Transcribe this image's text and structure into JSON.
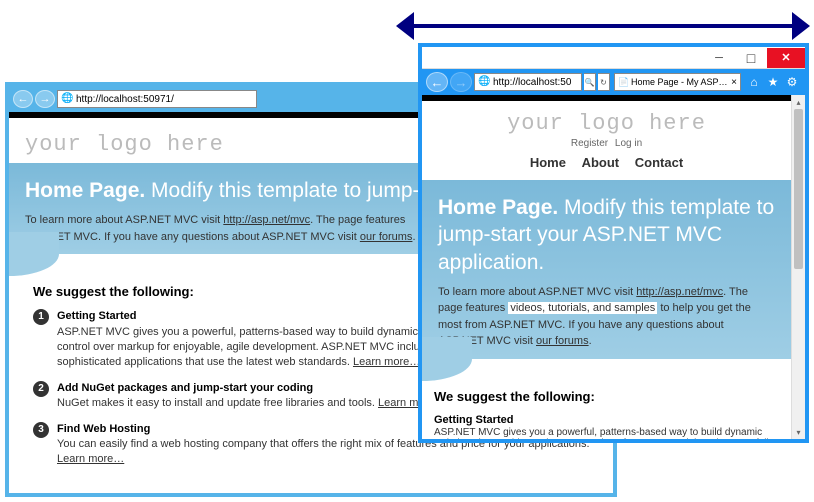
{
  "arrow": {
    "name": "resize-arrow"
  },
  "back_window": {
    "url": "http://localhost:50971/",
    "logo": "your logo here",
    "hero_title_bold": "Home Page.",
    "hero_title_rest": " Modify this template to jump-start",
    "hero_para_1": "To learn more about ASP.NET MVC visit ",
    "hero_link_1": "http://asp.net/mvc",
    "hero_para_2": ". The page features ",
    "hero_para_3": "ASP.NET MVC. If you have any questions about ASP.NET MVC visit ",
    "hero_link_2": "our forums",
    "hero_para_4": ".",
    "suggest_heading": "We suggest the following:",
    "items": [
      {
        "num": "1",
        "title": "Getting Started",
        "desc": "ASP.NET MVC gives you a powerful, patterns-based way to build dynamic websi",
        "desc2": "control over markup for enjoyable, agile development. ASP.NET MVC includes m",
        "desc3": "sophisticated applications that use the latest web standards. ",
        "learn": "Learn more…"
      },
      {
        "num": "2",
        "title": "Add NuGet packages and jump-start your coding",
        "desc": "NuGet makes it easy to install and update free libraries and tools. ",
        "learn": "Learn more…"
      },
      {
        "num": "3",
        "title": "Find Web Hosting",
        "desc": "You can easily find a web hosting company that offers the right mix of features and price for your applications. ",
        "learn": "Learn more…"
      }
    ]
  },
  "front_window": {
    "url": "http://localhost:50",
    "tab_title": "Home Page - My ASP…",
    "logo": "your logo here",
    "auth_register": "Register",
    "auth_login": "Log in",
    "nav_home": "Home",
    "nav_about": "About",
    "nav_contact": "Contact",
    "hero_title_bold": "Home Page.",
    "hero_title_rest": " Modify this template to jump-start your ASP.NET MVC application.",
    "hero_para_1a": "To learn more about ASP.NET MVC visit ",
    "hero_link_1": "http://asp.net/mvc",
    "hero_para_1b": ". The page features ",
    "hero_highlight": "videos, tutorials, and samples",
    "hero_para_1c": " to help you get the most from ASP.NET MVC. If you have any questions about ASP.NET MVC visit ",
    "hero_link_2": "our forums",
    "hero_para_1d": ".",
    "suggest_heading": "We suggest the following:",
    "item_title": "Getting Started",
    "item_desc": "ASP.NET MVC gives you a powerful, patterns-based way to build dynamic websites that enables a clean separation of concerns and that gives you full control over markup for enjoyable, agile development. ASP.NET MVC includes many features that enable fast, TDD-friendly development for creating sophisticated applications"
  }
}
